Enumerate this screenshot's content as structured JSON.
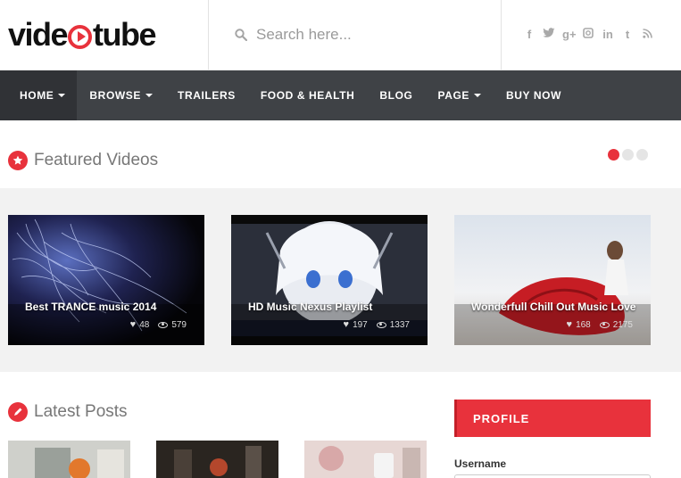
{
  "header": {
    "logo_prefix": "vide",
    "logo_suffix": "tube",
    "search_placeholder": "Search here...",
    "social_icons": [
      "facebook-icon",
      "twitter-icon",
      "google-plus-icon",
      "instagram-icon",
      "linkedin-icon",
      "tumblr-icon",
      "rss-icon"
    ]
  },
  "nav": {
    "items": [
      {
        "label": "HOME",
        "dropdown": true
      },
      {
        "label": "BROWSE",
        "dropdown": true
      },
      {
        "label": "TRAILERS",
        "dropdown": false
      },
      {
        "label": "FOOD & HEALTH",
        "dropdown": false
      },
      {
        "label": "BLOG",
        "dropdown": false
      },
      {
        "label": "PAGE",
        "dropdown": true
      },
      {
        "label": "BUY NOW",
        "dropdown": false
      }
    ]
  },
  "featured": {
    "title": "Featured Videos",
    "videos": [
      {
        "title": "Best TRANCE music 2014",
        "likes": "48",
        "views": "579"
      },
      {
        "title": "HD Music Nexus Playlist",
        "likes": "197",
        "views": "1337"
      },
      {
        "title": "Wonderfull Chill Out Music Love",
        "likes": "168",
        "views": "2175"
      }
    ]
  },
  "latest": {
    "title": "Latest Posts"
  },
  "profile": {
    "title": "PROFILE",
    "username_label": "Username"
  },
  "colors": {
    "accent": "#e8323c",
    "nav_bg": "#3f4246"
  }
}
